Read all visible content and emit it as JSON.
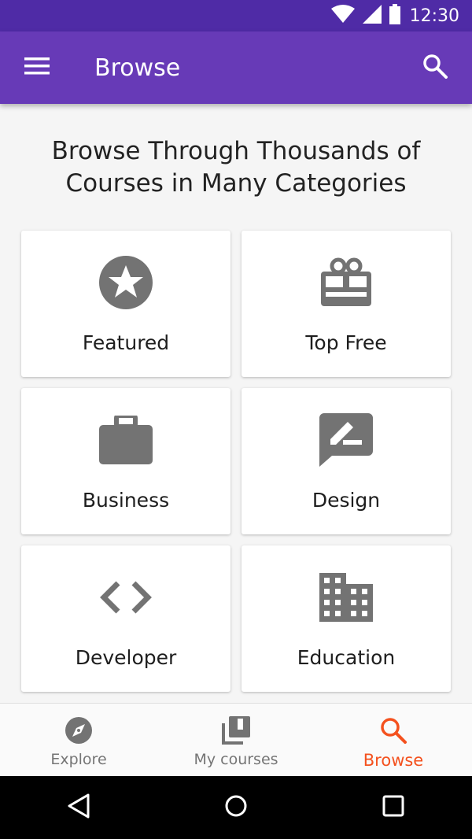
{
  "status_bar": {
    "time": "12:30",
    "icons": [
      "wifi-icon",
      "cell-signal-icon",
      "battery-icon"
    ]
  },
  "app_bar": {
    "title": "Browse",
    "left_icon": "menu-icon",
    "right_icon": "search-icon",
    "background": "#673ab7"
  },
  "headline": "Browse Through Thousands of Courses in Many Categories",
  "categories": [
    {
      "label": "Featured",
      "icon": "star-circle-icon"
    },
    {
      "label": "Top Free",
      "icon": "gift-card-icon"
    },
    {
      "label": "Business",
      "icon": "briefcase-icon"
    },
    {
      "label": "Design",
      "icon": "rate-review-pen-icon"
    },
    {
      "label": "Developer",
      "icon": "code-icon"
    },
    {
      "label": "Education",
      "icon": "building-icon"
    }
  ],
  "bottom_nav": {
    "items": [
      {
        "label": "Explore",
        "icon": "compass-icon",
        "active": false
      },
      {
        "label": "My courses",
        "icon": "library-icon",
        "active": false
      },
      {
        "label": "Browse",
        "icon": "search-icon",
        "active": true
      }
    ],
    "active_color": "#f4511e",
    "inactive_color": "#757575"
  },
  "system_nav": {
    "icons": [
      "back-icon",
      "home-icon",
      "recents-icon"
    ]
  }
}
